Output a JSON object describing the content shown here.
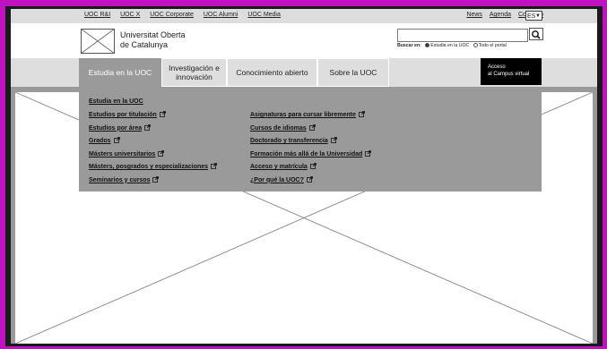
{
  "utility_bar": {
    "links": [
      "UOC R&I",
      "UOC X",
      "UOC Corporate",
      "UOC Alumni",
      "UOC Media"
    ],
    "right_links": [
      "News",
      "Agenda",
      "Contacto"
    ],
    "language": "ES"
  },
  "header": {
    "brand_line1": "Universitat Oberta",
    "brand_line2": "de Catalunya",
    "search": {
      "label": "Buscar en:",
      "option_study": "Estudia en la UOC",
      "option_all": "Todo el portal"
    }
  },
  "nav": {
    "items": [
      {
        "label": "Estudia en la UOC",
        "active": true
      },
      {
        "label": "Investigación e innovación",
        "active": false
      },
      {
        "label": "Conocimiento abierto",
        "active": false
      },
      {
        "label": "Sobre la UOC",
        "active": false
      }
    ],
    "campus_line1": "Acceso",
    "campus_line2": "al Campus virtual"
  },
  "dropdown": {
    "heading": "Estudia en la UOC",
    "left_links": [
      "Estudios por titulación",
      "Estudios por área",
      "Grados",
      "Másters universitarios",
      "Másters, posgrados y especializaciones",
      "Seminarios y cursos"
    ],
    "right_links": [
      "Asignaturas para cursar libremente",
      "Cursos de idiomas",
      "Doctorado y transferencia",
      "Formación más allá de la Universidad",
      "Acceso y matrícula",
      "¿Por qué la UOC?"
    ]
  },
  "colors": {
    "frame": "#c012c0",
    "nav_active": "#9a9a9a",
    "campus_bg": "#000000"
  }
}
